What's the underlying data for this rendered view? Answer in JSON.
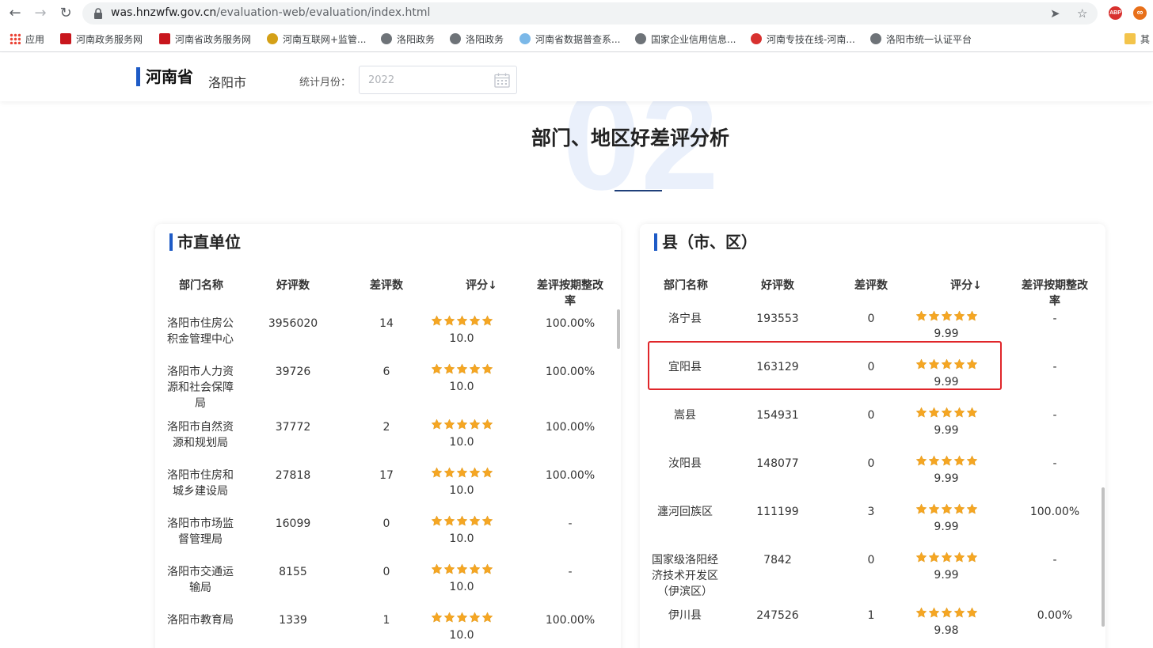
{
  "browser": {
    "url_host": "was.hnzwfw.gov.cn",
    "url_path": "/evaluation-web/evaluation/index.html",
    "bookmarks": [
      {
        "label": "应用",
        "icon": "apps-grid-icon"
      },
      {
        "label": "河南政务服务网",
        "icon": "henan-gov-icon"
      },
      {
        "label": "河南省政务服务网",
        "icon": "henan-gov-icon"
      },
      {
        "label": "河南互联网+监管...",
        "icon": "emblem-icon"
      },
      {
        "label": "洛阳政务",
        "icon": "globe-icon"
      },
      {
        "label": "洛阳政务",
        "icon": "globe-icon"
      },
      {
        "label": "河南省数据普查系...",
        "icon": "cloud-icon"
      },
      {
        "label": "国家企业信用信息...",
        "icon": "globe-icon"
      },
      {
        "label": "河南专技在线-河南...",
        "icon": "flame-icon"
      },
      {
        "label": "洛阳市统一认证平台",
        "icon": "globe-icon"
      },
      {
        "label": "其",
        "icon": "folder-icon"
      }
    ],
    "extensions": [
      "ABP",
      "∞"
    ]
  },
  "header": {
    "province": "河南省",
    "city": "洛阳市",
    "month_label": "统计月份：",
    "month_value": "2022"
  },
  "section": {
    "bg_number": "02",
    "title": "部门、地区好差评分析"
  },
  "columns": {
    "name": "部门名称",
    "good": "好评数",
    "bad": "差评数",
    "score": "评分↓",
    "rate": "差评按期整改率"
  },
  "left_panel": {
    "title": "市直单位",
    "rows": [
      {
        "name": "洛阳市住房公积金管理中心",
        "good": "3956020",
        "bad": "14",
        "score": "10.0",
        "rate": "100.00%"
      },
      {
        "name": "洛阳市人力资源和社会保障局",
        "good": "39726",
        "bad": "6",
        "score": "10.0",
        "rate": "100.00%"
      },
      {
        "name": "洛阳市自然资源和规划局",
        "good": "37772",
        "bad": "2",
        "score": "10.0",
        "rate": "100.00%"
      },
      {
        "name": "洛阳市住房和城乡建设局",
        "good": "27818",
        "bad": "17",
        "score": "10.0",
        "rate": "100.00%"
      },
      {
        "name": "洛阳市市场监督管理局",
        "good": "16099",
        "bad": "0",
        "score": "10.0",
        "rate": "-"
      },
      {
        "name": "洛阳市交通运输局",
        "good": "8155",
        "bad": "0",
        "score": "10.0",
        "rate": "-"
      },
      {
        "name": "洛阳市教育局",
        "good": "1339",
        "bad": "1",
        "score": "10.0",
        "rate": "100.00%"
      }
    ]
  },
  "right_panel": {
    "title": "县（市、区）",
    "rows": [
      {
        "name": "洛宁县",
        "good": "193553",
        "bad": "0",
        "score": "9.99",
        "rate": "-"
      },
      {
        "name": "宜阳县",
        "good": "163129",
        "bad": "0",
        "score": "9.99",
        "rate": "-"
      },
      {
        "name": "嵩县",
        "good": "154931",
        "bad": "0",
        "score": "9.99",
        "rate": "-"
      },
      {
        "name": "汝阳县",
        "good": "148077",
        "bad": "0",
        "score": "9.99",
        "rate": "-"
      },
      {
        "name": "瀍河回族区",
        "good": "111199",
        "bad": "3",
        "score": "9.99",
        "rate": "100.00%"
      },
      {
        "name": "国家级洛阳经济技术开发区（伊滨区）",
        "good": "7842",
        "bad": "0",
        "score": "9.99",
        "rate": "-"
      },
      {
        "name": "伊川县",
        "good": "247526",
        "bad": "1",
        "score": "9.98",
        "rate": "0.00%"
      }
    ]
  },
  "colors": {
    "accent": "#1e5bc6",
    "star": "#f5a623",
    "highlight": "#e0262a"
  }
}
